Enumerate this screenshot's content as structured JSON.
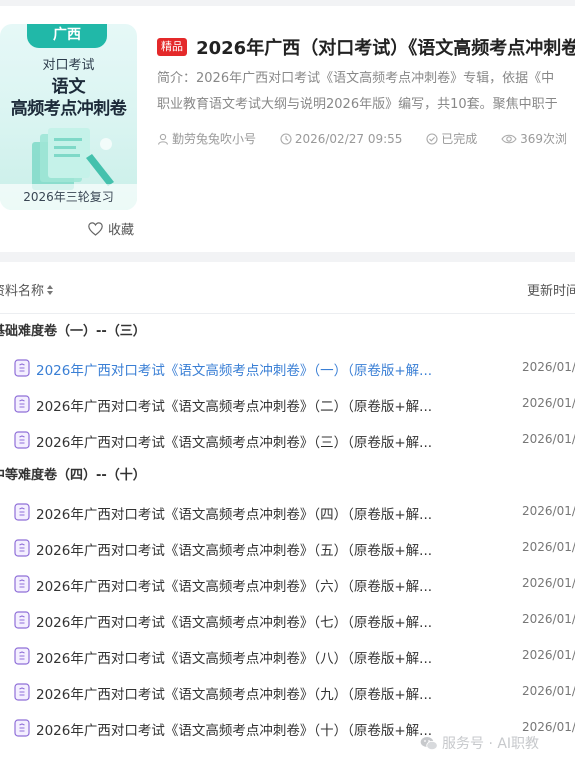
{
  "cover": {
    "badge": "广西",
    "line1": "对口考试",
    "line2": "语文",
    "line3": "高频考点冲刺卷",
    "footer": "2026年三轮复习"
  },
  "header": {
    "tag": "精品",
    "title": "2026年广西（对口考试）《语文高频考点冲刺卷",
    "desc_line1": "简介：2026年广西对口考试《语文高频考点冲刺卷》专辑，依据《中",
    "desc_line2": "职业教育语文考试大纲与说明2026年版》编写，共10套。聚焦中职于",
    "author": "勤劳兔兔吹小号",
    "date": "2026/02/27 09:55",
    "status": "已完成",
    "views": "369次浏",
    "favorite_label": "收藏"
  },
  "list": {
    "col_name": "资料名称",
    "col_time": "更新时间",
    "groups": [
      {
        "label": "基础难度卷（一）--（三）",
        "items": [
          {
            "name": "2026年广西对口考试《语文高频考点冲刺卷》（一）（原卷版+解...",
            "date": "2026/01/",
            "active": true
          },
          {
            "name": "2026年广西对口考试《语文高频考点冲刺卷》（二）（原卷版+解...",
            "date": "2026/01/"
          },
          {
            "name": "2026年广西对口考试《语文高频考点冲刺卷》（三）（原卷版+解...",
            "date": "2026/01/"
          }
        ]
      },
      {
        "label": "中等难度卷（四）--（十）",
        "items": [
          {
            "name": "2026年广西对口考试《语文高频考点冲刺卷》（四）（原卷版+解...",
            "date": "2026/01/"
          },
          {
            "name": "2026年广西对口考试《语文高频考点冲刺卷》（五）（原卷版+解...",
            "date": "2026/01/"
          },
          {
            "name": "2026年广西对口考试《语文高频考点冲刺卷》（六）（原卷版+解...",
            "date": "2026/01/"
          },
          {
            "name": "2026年广西对口考试《语文高频考点冲刺卷》（七）（原卷版+解...",
            "date": "2026/01/"
          },
          {
            "name": "2026年广西对口考试《语文高频考点冲刺卷》（八）（原卷版+解...",
            "date": "2026/01/"
          },
          {
            "name": "2026年广西对口考试《语文高频考点冲刺卷》（九）（原卷版+解...",
            "date": "2026/01/"
          },
          {
            "name": "2026年广西对口考试《语文高频考点冲刺卷》（十）（原卷版+解...",
            "date": "2026/01/"
          }
        ]
      }
    ]
  },
  "watermark": "服务号 · AI职教",
  "colors": {
    "accent": "#3a7fd5",
    "tag": "#e4292a",
    "cover_badge": "#21b8a8",
    "doc_icon": "#8f6fd8"
  }
}
